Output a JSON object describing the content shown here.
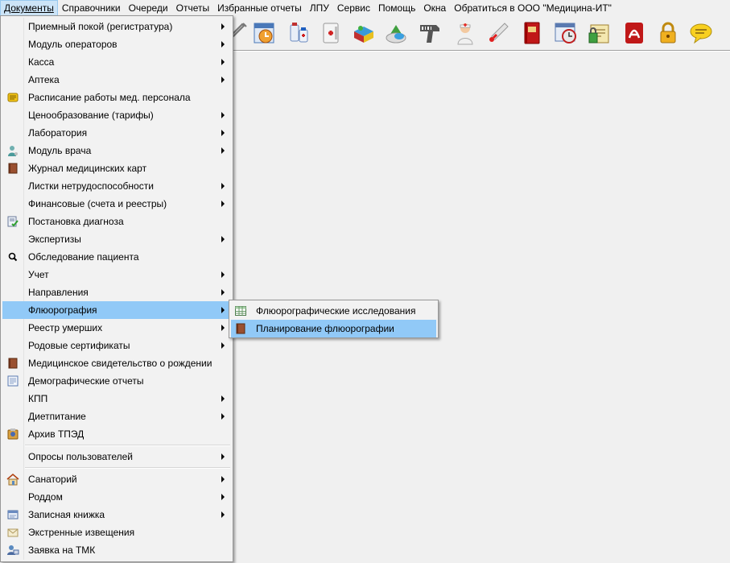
{
  "menubar": {
    "items": [
      "Документы",
      "Справочники",
      "Очереди",
      "Отчеты",
      "Избранные отчеты",
      "ЛПУ",
      "Сервис",
      "Помощь",
      "Окна",
      "Обратиться в ООО \"Медицина-ИТ\""
    ]
  },
  "toolbar": {
    "buttons": [
      "syringe-icon",
      "calendar-clock-icon",
      "medicine-bottles-icon",
      "first-aid-icon",
      "pills-box-icon",
      "capsules-icon",
      "barcode-scanner-icon",
      "nurse-icon",
      "thermometer-icon",
      "red-book-icon",
      "clock-card-icon",
      "security-document-icon",
      "acrobat-icon",
      "padlock-icon",
      "chat-bubble-icon"
    ]
  },
  "menu": {
    "items": [
      {
        "label": "Приемный покой (регистратура)",
        "icon": "",
        "submenu": true
      },
      {
        "label": "Модуль операторов",
        "icon": "",
        "submenu": true
      },
      {
        "label": "Касса",
        "icon": "",
        "submenu": true
      },
      {
        "label": "Аптека",
        "icon": "",
        "submenu": true
      },
      {
        "label": "Расписание работы мед. персонала",
        "icon": "schedule-icon",
        "submenu": false
      },
      {
        "label": "Ценообразование (тарифы)",
        "icon": "",
        "submenu": true
      },
      {
        "label": "Лаборатория",
        "icon": "",
        "submenu": true
      },
      {
        "label": "Модуль врача",
        "icon": "doctor-icon",
        "submenu": true
      },
      {
        "label": "Журнал медицинских карт",
        "icon": "journal-icon",
        "submenu": false
      },
      {
        "label": "Листки нетрудоспособности",
        "icon": "",
        "submenu": true
      },
      {
        "label": "Финансовые (счета и реестры)",
        "icon": "",
        "submenu": true
      },
      {
        "label": "Постановка диагноза",
        "icon": "diagnosis-icon",
        "submenu": false
      },
      {
        "label": "Экспертизы",
        "icon": "",
        "submenu": true
      },
      {
        "label": "Обследование пациента",
        "icon": "magnifier-icon",
        "submenu": false
      },
      {
        "label": "Учет",
        "icon": "",
        "submenu": true
      },
      {
        "label": "Направления",
        "icon": "",
        "submenu": true
      },
      {
        "label": "Флюорография",
        "icon": "",
        "submenu": true,
        "highlighted": true
      },
      {
        "label": "Реестр умерших",
        "icon": "",
        "submenu": true
      },
      {
        "label": "Родовые сертификаты",
        "icon": "",
        "submenu": true
      },
      {
        "label": "Медицинское свидетельство о рождении",
        "icon": "certificate-book-icon",
        "submenu": false
      },
      {
        "label": "Демографические отчеты",
        "icon": "report-icon",
        "submenu": false
      },
      {
        "label": "КПП",
        "icon": "",
        "submenu": true
      },
      {
        "label": "Диетпитание",
        "icon": "",
        "submenu": true
      },
      {
        "label": "Архив ТПЭД",
        "icon": "archive-icon",
        "submenu": false
      },
      {
        "label": "Опросы пользователей",
        "icon": "",
        "submenu": true
      },
      {
        "label": "Санаторий",
        "icon": "house-icon",
        "submenu": true
      },
      {
        "label": "Роддом",
        "icon": "",
        "submenu": true
      },
      {
        "label": "Записная книжка",
        "icon": "notebook-icon",
        "submenu": true
      },
      {
        "label": "Экстренные извещения",
        "icon": "envelope-icon",
        "submenu": false
      },
      {
        "label": "Заявка на ТМК",
        "icon": "telemedicine-icon",
        "submenu": false
      }
    ]
  },
  "submenu": {
    "items": [
      {
        "label": "Флюорографические исследования",
        "icon": "table-grid-icon"
      },
      {
        "label": "Планирование флюорографии",
        "icon": "planning-book-icon",
        "highlighted": true
      }
    ]
  }
}
